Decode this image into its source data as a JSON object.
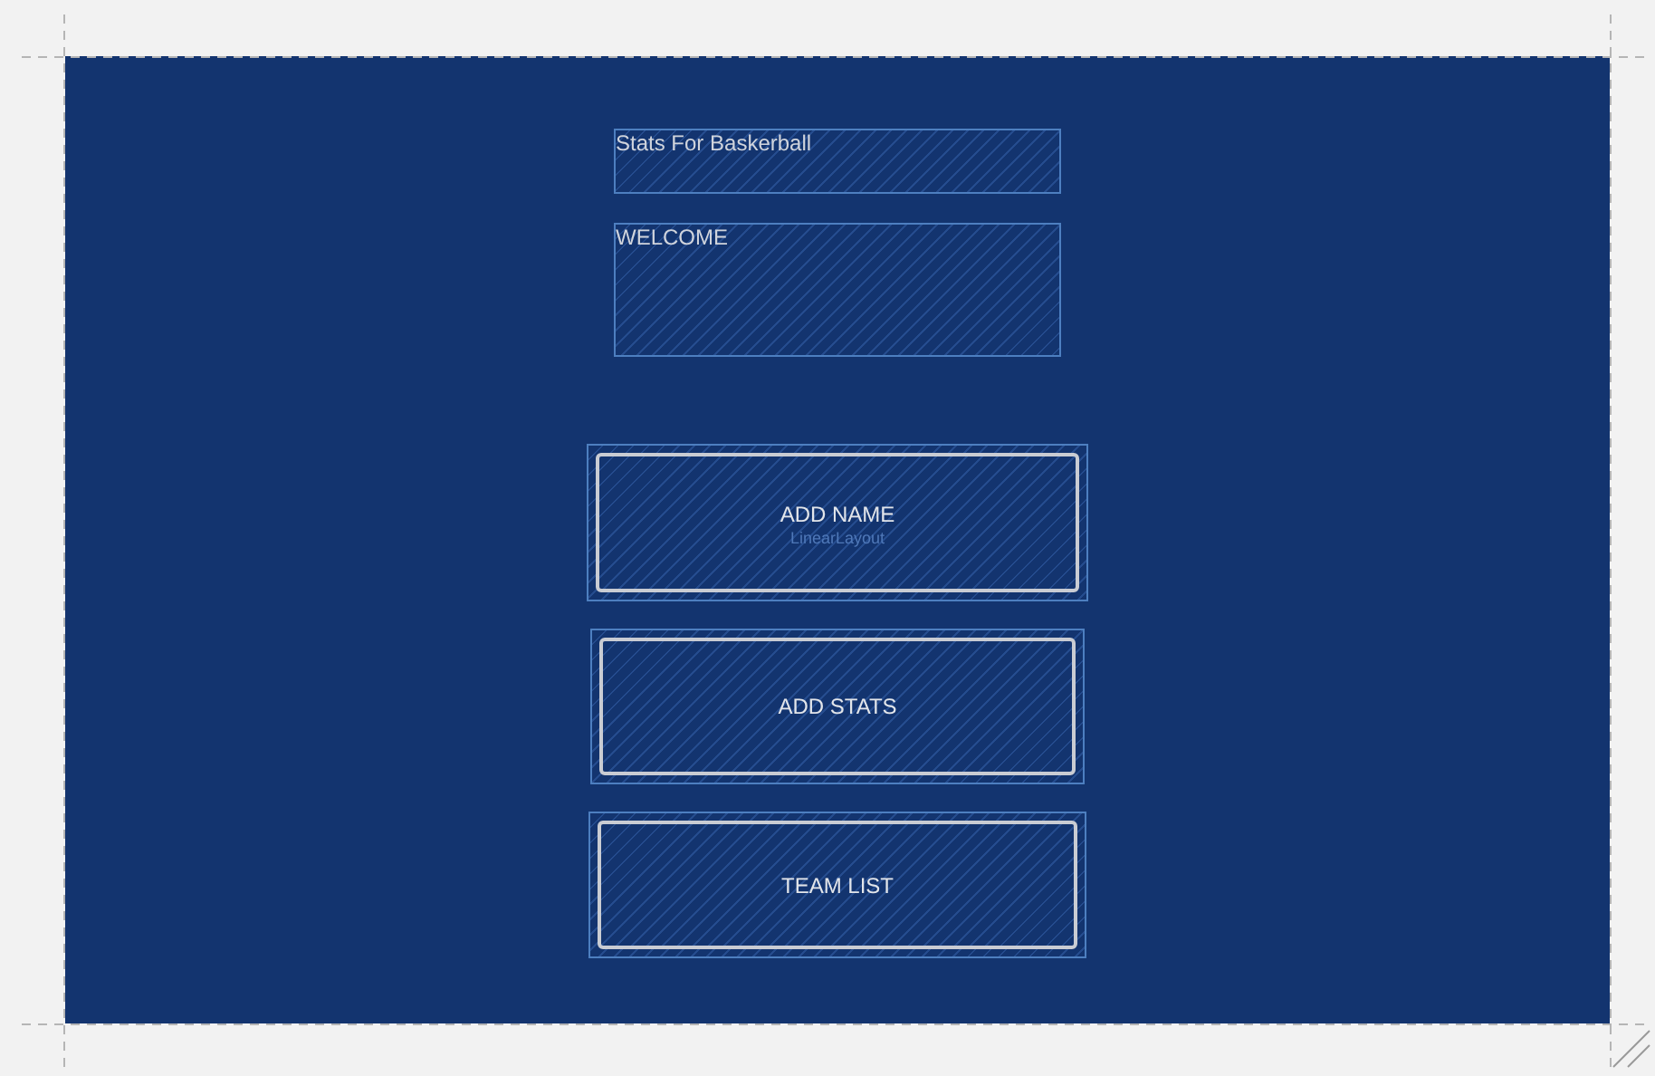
{
  "text_views": [
    {
      "text": "Stats For Baskerball"
    },
    {
      "text": "WELCOME"
    }
  ],
  "buttons": [
    {
      "label": "ADD NAME",
      "layout_label": "LinearLayout"
    },
    {
      "label": "ADD STATS"
    },
    {
      "label": "TEAM LIST"
    }
  ]
}
